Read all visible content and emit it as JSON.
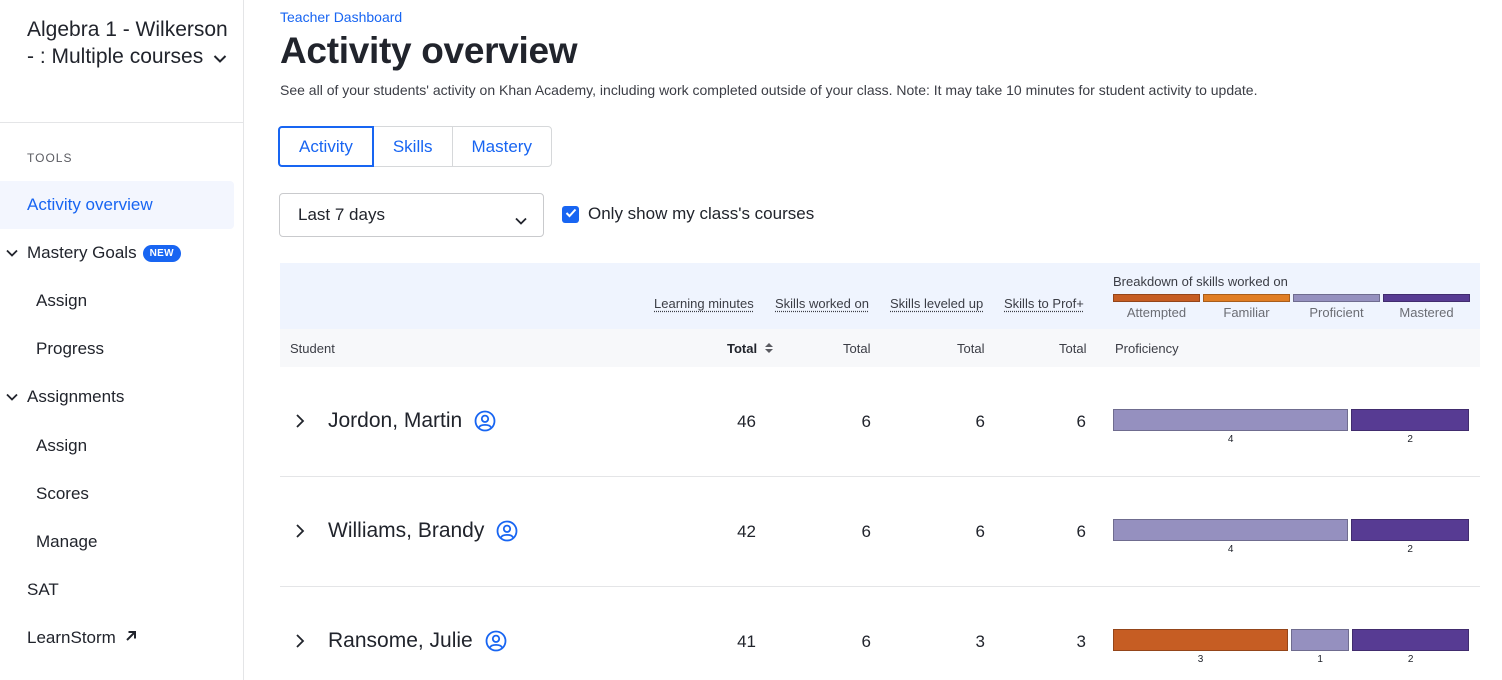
{
  "sidebar": {
    "class_name": "Algebra 1 - Wilkerson - : Multiple courses",
    "tools_label": "TOOLS",
    "items": [
      {
        "label": "Activity overview"
      },
      {
        "label": "Mastery Goals",
        "badge": "NEW"
      },
      {
        "label": "Assign"
      },
      {
        "label": "Progress"
      },
      {
        "label": "Assignments"
      },
      {
        "label": "Assign"
      },
      {
        "label": "Scores"
      },
      {
        "label": "Manage"
      },
      {
        "label": "SAT"
      },
      {
        "label": "LearnStorm"
      }
    ]
  },
  "header": {
    "breadcrumb": "Teacher Dashboard",
    "title": "Activity overview",
    "description": "See all of your students' activity on Khan Academy, including work completed outside of your class. Note: It may take 10 minutes for student activity to update."
  },
  "tabs": [
    {
      "label": "Activity"
    },
    {
      "label": "Skills"
    },
    {
      "label": "Mastery"
    }
  ],
  "filters": {
    "date_range": "Last 7 days",
    "only_my_courses_label": "Only show my class's courses",
    "only_my_courses_checked": true
  },
  "table": {
    "col_learning_minutes": "Learning minutes",
    "col_skills_worked_on": "Skills worked on",
    "col_skills_leveled_up": "Skills leveled up",
    "col_skills_to_prof": "Skills to Prof+",
    "breakdown_title": "Breakdown of skills worked on",
    "legend": [
      {
        "label": "Attempted",
        "color": "#c65d23"
      },
      {
        "label": "Familiar",
        "color": "#e07d24"
      },
      {
        "label": "Proficient",
        "color": "#9590bf"
      },
      {
        "label": "Mastered",
        "color": "#573b93"
      }
    ],
    "sub_student": "Student",
    "sub_total": "Total",
    "sub_proficiency": "Proficiency",
    "rows": [
      {
        "name": "Jordon, Martin",
        "learning_minutes": "46",
        "worked_on": "6",
        "leveled_up": "6",
        "to_prof": "6",
        "breakdown": {
          "attempted": 0,
          "familiar": 0,
          "proficient": 4,
          "mastered": 2
        }
      },
      {
        "name": "Williams, Brandy",
        "learning_minutes": "42",
        "worked_on": "6",
        "leveled_up": "6",
        "to_prof": "6",
        "breakdown": {
          "attempted": 0,
          "familiar": 0,
          "proficient": 4,
          "mastered": 2
        }
      },
      {
        "name": "Ransome, Julie",
        "learning_minutes": "41",
        "worked_on": "6",
        "leveled_up": "3",
        "to_prof": "3",
        "breakdown": {
          "attempted": 3,
          "familiar": 0,
          "proficient": 1,
          "mastered": 2
        }
      }
    ]
  }
}
